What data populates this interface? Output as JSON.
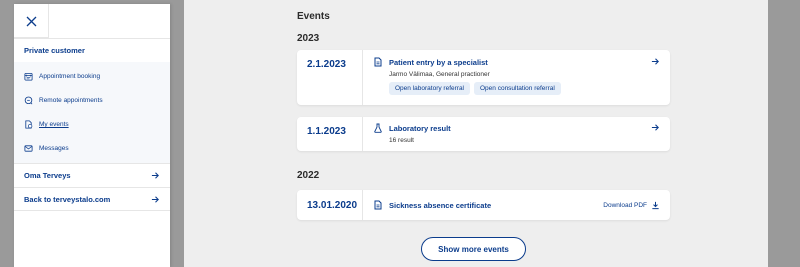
{
  "sidebar": {
    "section_title": "Private customer",
    "items": [
      {
        "label": "Appointment booking",
        "icon": "calendar-icon"
      },
      {
        "label": "Remote appointments",
        "icon": "chat-icon"
      },
      {
        "label": "My events",
        "icon": "events-icon",
        "active": true
      },
      {
        "label": "Messages",
        "icon": "mail-icon"
      }
    ],
    "links": [
      {
        "label": "Oma Terveys"
      },
      {
        "label": "Back to terveystalo.com"
      }
    ]
  },
  "main": {
    "heading": "Events",
    "years": [
      {
        "year": "2023",
        "events": [
          {
            "date": "2.1.2023",
            "title": "Patient entry by a specialist",
            "subtitle": "Jarmo Välimaa, General practioner",
            "chips": [
              "Open laboratory referral",
              "Open consultation referral"
            ]
          },
          {
            "date": "1.1.2023",
            "title": "Laboratory result",
            "subtitle": "16 result"
          }
        ]
      },
      {
        "year": "2022",
        "events": [
          {
            "date": "13.01.2020",
            "title": "Sickness absence certificate",
            "download_label": "Download PDF"
          }
        ]
      }
    ],
    "show_more_label": "Show more events"
  },
  "colors": {
    "brand_blue": "#0b3c8c",
    "overlay_gray": "#9a9a9a",
    "content_bg": "#eeeeee"
  }
}
